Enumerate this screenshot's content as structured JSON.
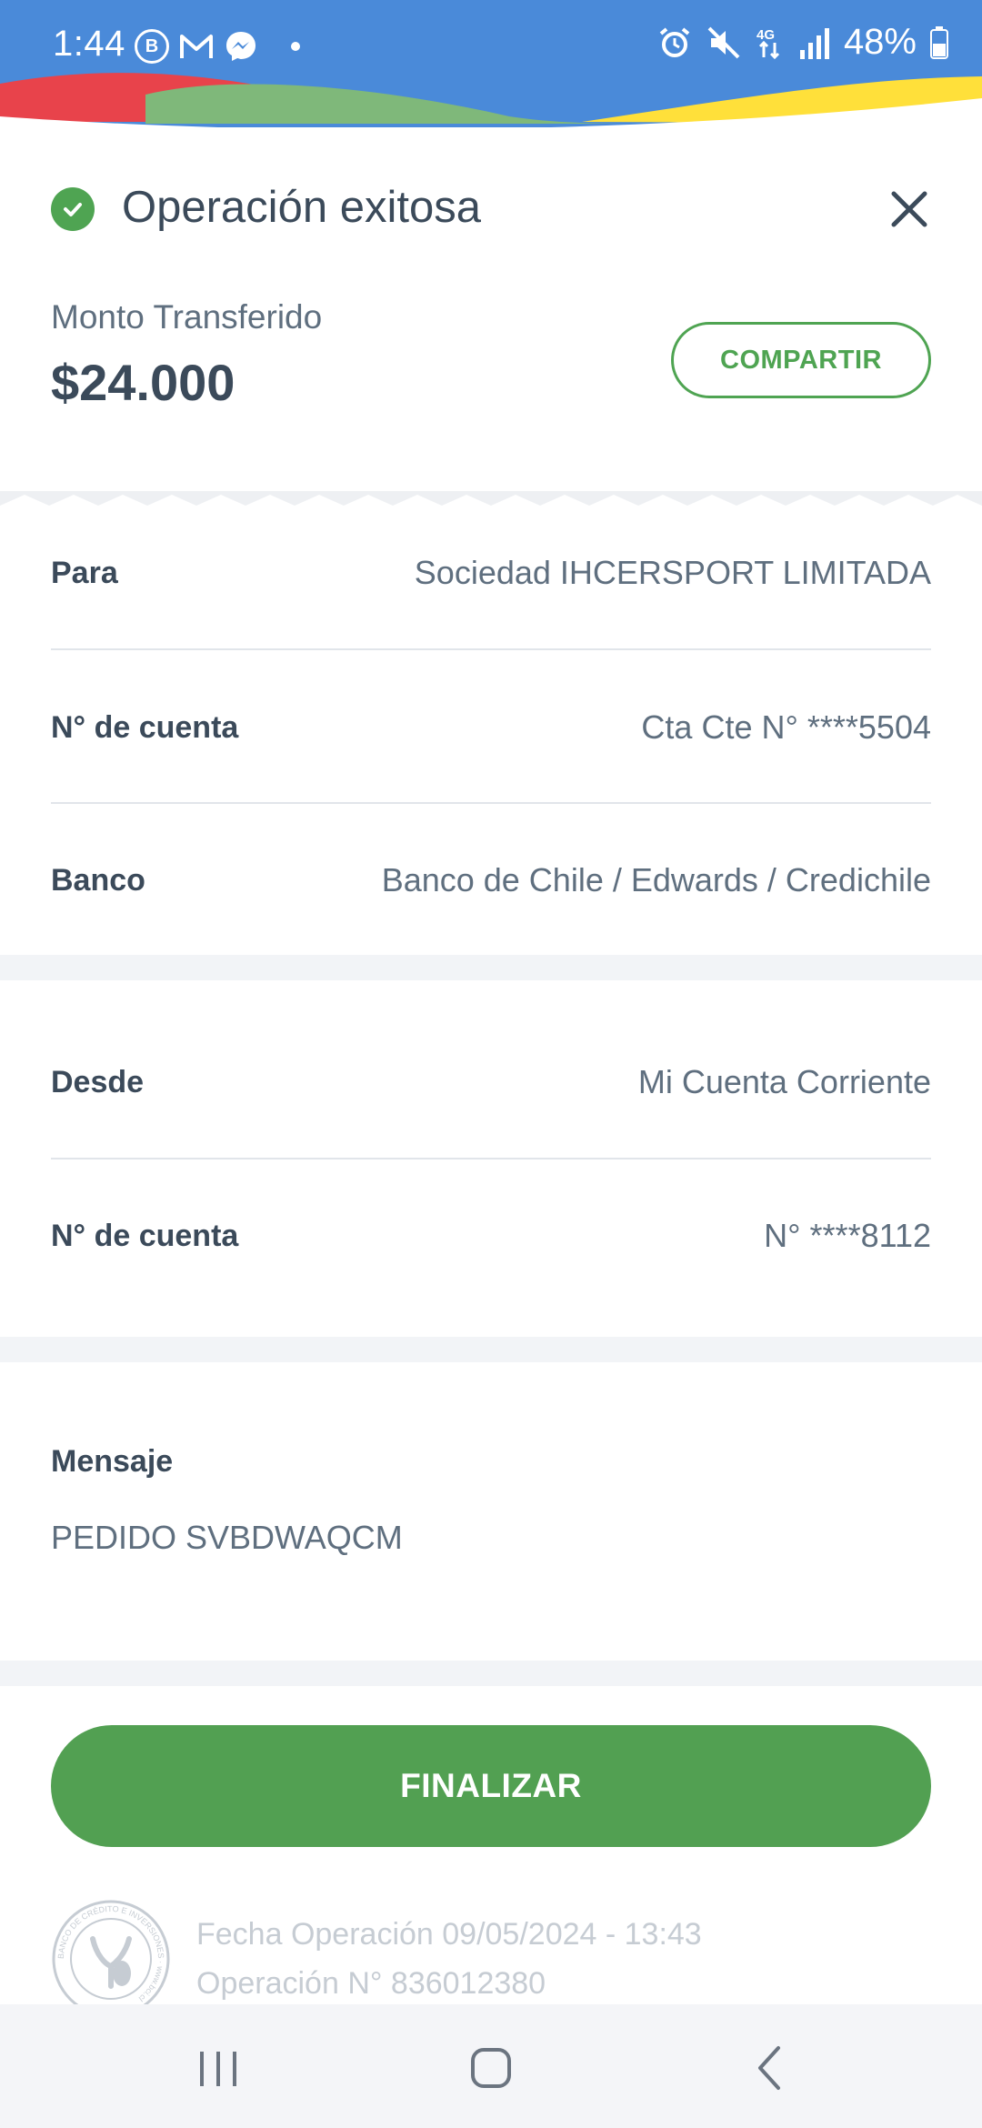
{
  "status_bar": {
    "time": "1:44",
    "battery": "48%",
    "left_icons": [
      "b-circle-icon",
      "gmail-icon",
      "messenger-icon",
      "dot-icon"
    ],
    "right_icons": [
      "alarm-icon",
      "mute-icon",
      "4g-icon",
      "signal-icon",
      "battery-icon"
    ]
  },
  "header": {
    "title": "Operación exitosa",
    "amount_label": "Monto Transferido",
    "amount": "$24.000",
    "share_label": "COMPARTIR"
  },
  "to_section": {
    "rows": [
      {
        "label": "Para",
        "value": "Sociedad IHCERSPORT LIMITADA"
      },
      {
        "label": "N° de cuenta",
        "value": "Cta Cte N° ****5504"
      },
      {
        "label": "Banco",
        "value": "Banco de Chile / Edwards / Credichile"
      }
    ]
  },
  "from_section": {
    "rows": [
      {
        "label": "Desde",
        "value": "Mi Cuenta Corriente"
      },
      {
        "label": "N° de cuenta",
        "value": "N° ****8112"
      }
    ]
  },
  "message": {
    "label": "Mensaje",
    "value": "PEDIDO SVBDWAQCM"
  },
  "finish_label": "FINALIZAR",
  "footer": {
    "date_line": "Fecha Operación 09/05/2024 - 13:43",
    "op_line": "Operación N° 836012380",
    "seal_text": "BANCO DE CRÉDITO E INVERSIONES · www.bci.cl"
  },
  "colors": {
    "status_blue": "#4a8ad9",
    "success_green": "#4fa452",
    "text_dark": "#3b4a5a",
    "text_muted": "#5f6f7f",
    "section_gap": "#f2f4f7"
  }
}
